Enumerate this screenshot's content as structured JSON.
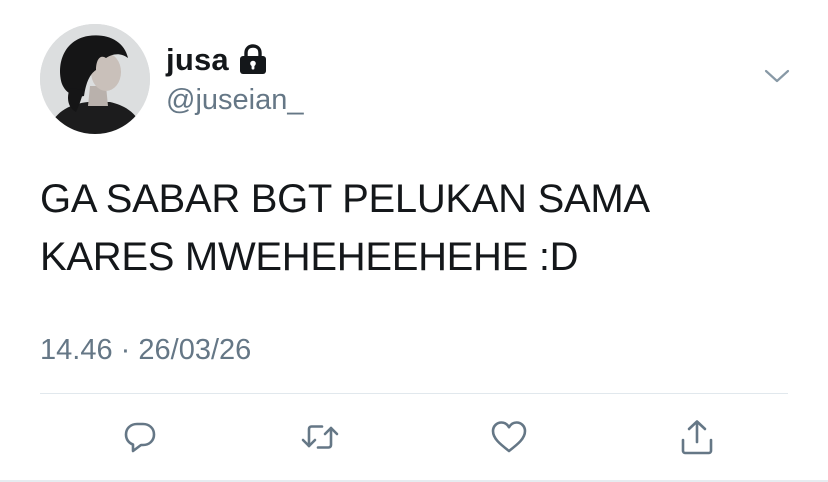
{
  "user": {
    "display_name": "jusa",
    "handle": "@juseian_",
    "protected": true,
    "protected_icon": "lock-icon",
    "avatar": "profile-photo"
  },
  "tweet": {
    "lines": [
      "GA SABAR BGT PELUKAN SAMA",
      "KARES MWEHEHEEHEHE :D"
    ],
    "time": "14.46",
    "separator": "·",
    "date": "26/03/26"
  },
  "header": {
    "menu_icon": "chevron-down-icon"
  },
  "actions": [
    {
      "icon": "reply-icon"
    },
    {
      "icon": "retweet-icon"
    },
    {
      "icon": "like-icon"
    },
    {
      "icon": "share-icon"
    }
  ],
  "colors": {
    "text": "#14171a",
    "secondary": "#657786",
    "divider": "#e1e8ed",
    "icon": "#657786",
    "background": "#ffffff"
  }
}
